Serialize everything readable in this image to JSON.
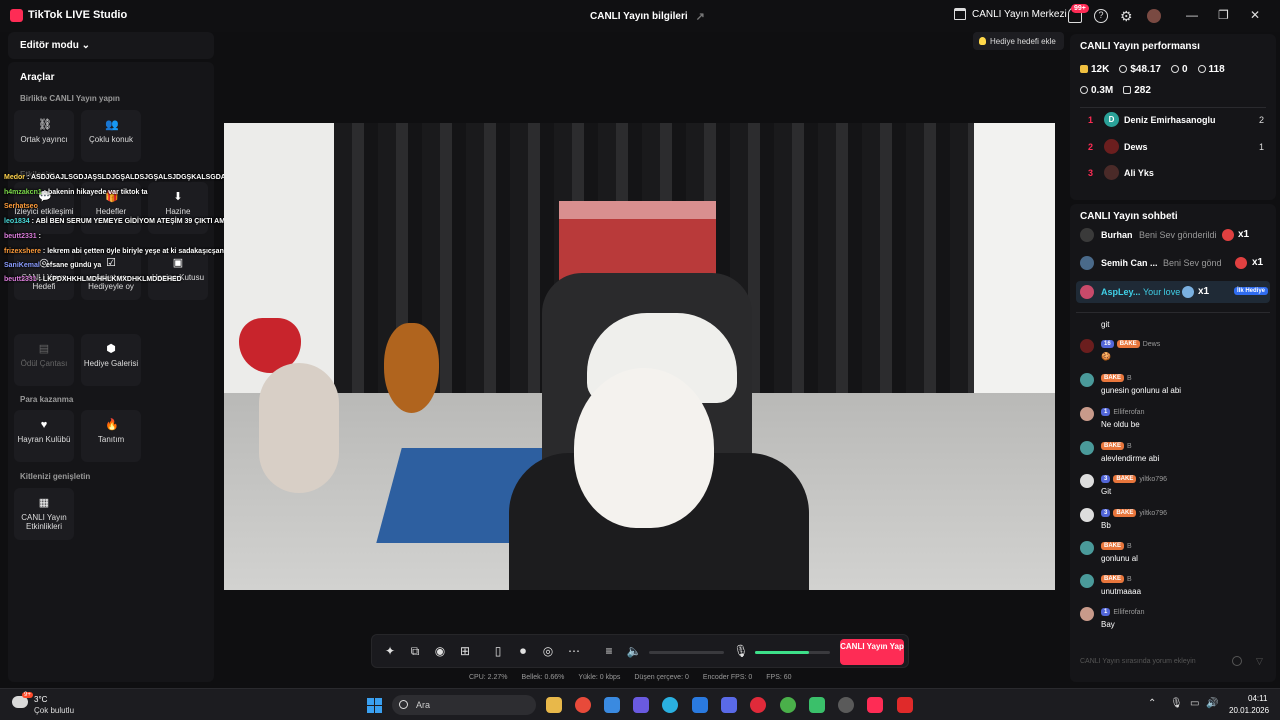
{
  "window": {
    "app_title": "TikTok LIVE Studio",
    "center_title": "CANLI Yayın bilgileri",
    "live_center": "CANLI Yayın Merkezi",
    "notif_badge": "99+",
    "help": "?",
    "minimize": "—",
    "maximize": "❐",
    "close": "✕"
  },
  "left": {
    "editor_mode": "Editör modu",
    "tools_title": "Araçlar",
    "section_together": "Birlikte CANLI Yayın yapın",
    "tools_together": [
      {
        "label": "Ortak yayıncı",
        "icon": "link-icon"
      },
      {
        "label": "Çoklu konuk",
        "icon": "users-icon"
      }
    ],
    "section_engage": "Etkileşim",
    "tools_engage": [
      {
        "label": "İzleyici etkileşimi",
        "icon": "chat-icon"
      },
      {
        "label": "Hedefler",
        "icon": "gift-icon"
      },
      {
        "label": "Hazine",
        "icon": "download-icon"
      },
      {
        "label": "CANLI Yayın Hedefi",
        "icon": "target-icon"
      },
      {
        "label": "Anket ve Hediyeyle oy",
        "icon": "poll-icon"
      },
      {
        "label": "Hazine Kutusu",
        "icon": "box-icon"
      },
      {
        "label": "Ödül Çantası",
        "icon": "bag-icon"
      },
      {
        "label": "Hediye Galerisi",
        "icon": "gallery-icon"
      }
    ],
    "section_earn": "Para kazanma",
    "tools_earn": [
      {
        "label": "Hayran Kulübü",
        "icon": "heart-icon"
      },
      {
        "label": "Tanıtım",
        "icon": "flame-icon"
      }
    ],
    "section_expand": "Kitlenizi genişletin",
    "tools_expand": [
      {
        "label": "CANLI Yayın Etkinlikleri",
        "icon": "calendar-icon"
      }
    ]
  },
  "overlay": [
    {
      "name": "Medor",
      "text": ": ASDJGAJLSGDJAŞSLDJGŞALDSJGŞALSJDGŞKALSGDA",
      "color": "y"
    },
    {
      "name": "h4mzakcn1",
      "text": ": bakenin hikayede var tiktok ta",
      "color": "g"
    },
    {
      "name": "Serhatseo",
      "text": "",
      "color": "o"
    },
    {
      "name": "leo1834",
      "text": ": ABİ BEN SERUM YEMEYE GİDİYOM ATEŞİM 39 ÇIKTI AMK BEN HAYLA BURDA İZLİYOM SENİ",
      "color": "c"
    },
    {
      "name": "beutt2331",
      "text": ":",
      "color": "p"
    },
    {
      "name": "frizexshere",
      "text": ": lekrem abi çetten öyle biriyle yeşe at ki sadakaşıcşanı ile iddia oynayalım hadi şimdi",
      "color": "o"
    },
    {
      "name": "SaniKemal",
      "text": ": efsane gündü ya",
      "color": "b"
    },
    {
      "name": "beutt2331",
      "text": ": LKPDXHKHLMDHHLKMXDHKLMDDEHED",
      "color": "p"
    }
  ],
  "stage": {
    "gift_goal": "Hediye hedefi ekle"
  },
  "controls": {
    "go_live": "CANLI Yayın Yap",
    "mic_level": 0.72
  },
  "stats": {
    "cpu": "CPU:  2.27%",
    "memory": "Bellek:  0.66%",
    "upload": "Yükle:  0 kbps",
    "dropped": "Düşen çerçeve:  0",
    "encoder_fps": "Encoder FPS:  0",
    "fps": "FPS:  60"
  },
  "performance": {
    "title": "CANLI Yayın performansı",
    "diamonds": "12K",
    "earnings": "$48.17",
    "new_followers": "0",
    "viewers": "118",
    "likes": "0.3M",
    "gifters": "282",
    "ranking": [
      {
        "rank": "1",
        "name": "Deniz Emirhasanoglu",
        "score": "2",
        "avatar": "D"
      },
      {
        "rank": "2",
        "name": "Dews",
        "score": "1",
        "avatar": ""
      },
      {
        "rank": "3",
        "name": "Ali Yks",
        "score": "",
        "avatar": ""
      }
    ]
  },
  "chat": {
    "title": "CANLI Yayın sohbeti",
    "gifts": [
      {
        "name": "Burhan",
        "text": "Beni Sev gönderildi",
        "count": "x1"
      },
      {
        "name": "Semih Can ...",
        "text": "Beni Sev gönd",
        "count": "x1"
      },
      {
        "name": "AspLey...",
        "text": "Your love",
        "count": "x1",
        "badge": "İlk Hediye"
      }
    ],
    "messages": [
      {
        "meta_level": "",
        "fan": "",
        "user": "",
        "text": "git"
      },
      {
        "meta_level": "16",
        "fan": "BAKE",
        "user": "Dews",
        "text": "🍪"
      },
      {
        "meta_level": "",
        "fan": "BAKE",
        "user": "B",
        "text": "gunesin gonlunu al abi"
      },
      {
        "meta_level": "1",
        "fan": "",
        "user": "Elliferofan",
        "text": "Ne oldu be"
      },
      {
        "meta_level": "",
        "fan": "BAKE",
        "user": "B",
        "text": "alevlendirme abi"
      },
      {
        "meta_level": "3",
        "fan": "BAKE",
        "user": "yiltko796",
        "text": "Git"
      },
      {
        "meta_level": "3",
        "fan": "BAKE",
        "user": "yiltko796",
        "text": "Bb"
      },
      {
        "meta_level": "",
        "fan": "BAKE",
        "user": "B",
        "text": "gonlunu al"
      },
      {
        "meta_level": "",
        "fan": "BAKE",
        "user": "B",
        "text": "unutmaaaa"
      },
      {
        "meta_level": "1",
        "fan": "",
        "user": "Elliferofan",
        "text": "Bay"
      }
    ],
    "input_placeholder": "CANLI Yayın sırasında yorum ekleyin"
  },
  "taskbar": {
    "temp": "3°C",
    "weather": "Çok bulutlu",
    "search": "Ara",
    "time": "04:11",
    "date": "20.01.2026",
    "weather_badge": "9+"
  }
}
